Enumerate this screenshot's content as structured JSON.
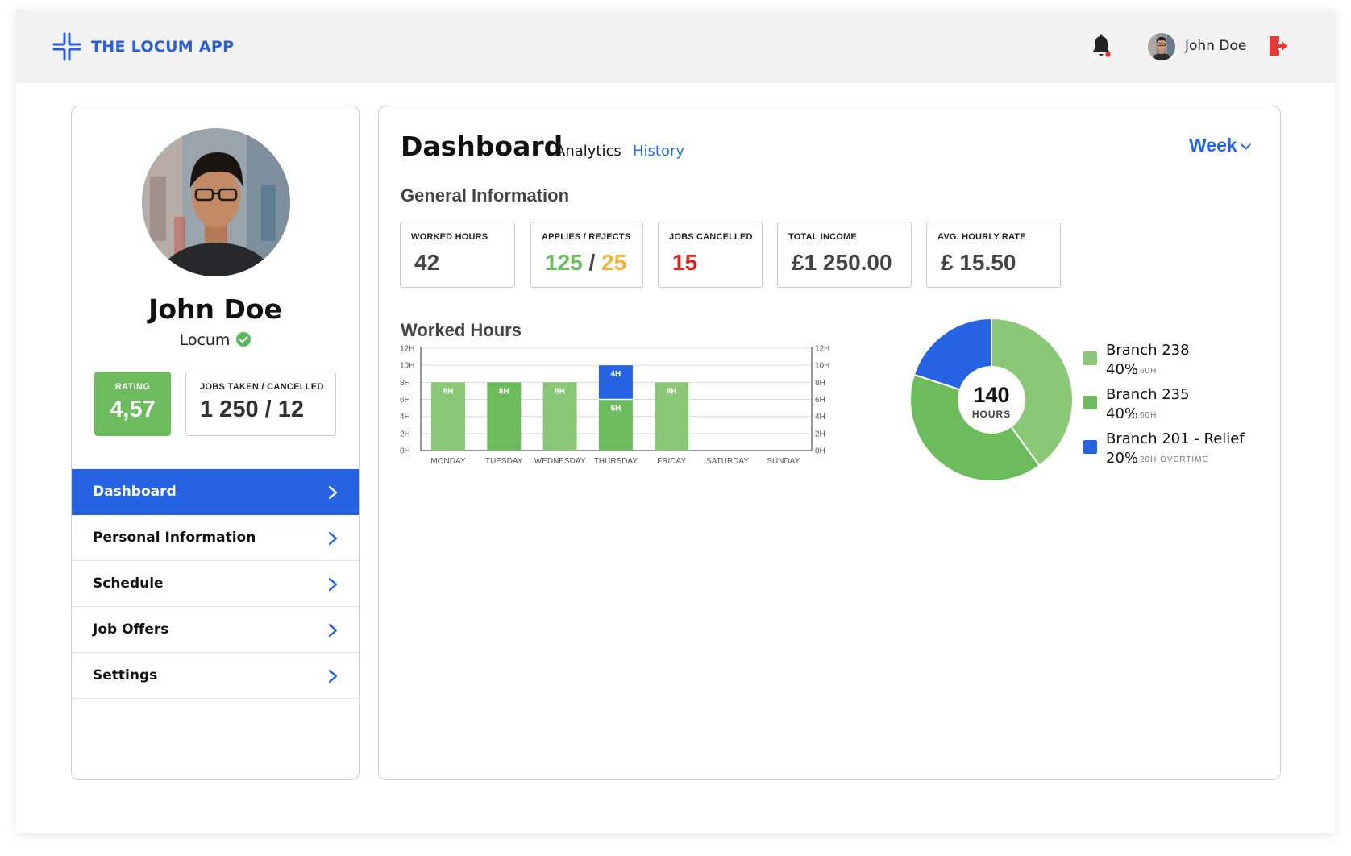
{
  "header": {
    "brand": "THE LOCUM APP",
    "user_name": "John Doe",
    "icons": [
      "logo-icon",
      "bell-icon",
      "avatar",
      "logout-icon"
    ],
    "notification_dot_color": "#e53935"
  },
  "profile": {
    "name": "John Doe",
    "role": "Locum",
    "rating_label": "RATING",
    "rating_value": "4,57",
    "jobs_label": "JOBS TAKEN / CANCELLED",
    "jobs_value": "1 250 / 12"
  },
  "nav": {
    "items": [
      {
        "label": "Dashboard",
        "active": true
      },
      {
        "label": "Personal Information",
        "active": false
      },
      {
        "label": "Schedule",
        "active": false
      },
      {
        "label": "Job Offers",
        "active": false
      },
      {
        "label": "Settings",
        "active": false
      }
    ]
  },
  "dashboard": {
    "title": "Dashboard",
    "tab_analytics": "Analytics",
    "tab_history": "History",
    "period": "Week",
    "general_title": "General Information",
    "worked_title": "Worked Hours",
    "cards": {
      "worked_hours": {
        "label": "WORKED HOURS",
        "value": "42"
      },
      "applies": {
        "label": "APPLIES / REJECTS",
        "applies": "125",
        "sep": " / ",
        "rejects": "25"
      },
      "jobs_cancelled": {
        "label": "JOBS CANCELLED",
        "value": "15"
      },
      "total_income": {
        "label": "TOTAL INCOME",
        "value": "£1 250.00"
      },
      "avg_rate": {
        "label": "AVG. HOURLY RATE",
        "value": "£ 15.50"
      }
    },
    "colors": {
      "green_light": "#8ac776",
      "green_mid": "#6cbc5e",
      "blue": "#2563e2",
      "applies_green": "#6cbc5e",
      "rejects_orange": "#f0b33b",
      "cancelled_red": "#d9251d"
    }
  },
  "chart_data": [
    {
      "type": "bar",
      "stacked": true,
      "categories": [
        "MONDAY",
        "TUESDAY",
        "WEDNESDAY",
        "THURSDAY",
        "FRIDAY",
        "SATURDAY",
        "SUNDAY"
      ],
      "series": [
        {
          "values": [
            8,
            8,
            8,
            6,
            8,
            0,
            0
          ],
          "colors": [
            "#8ac776",
            "#6cbc5e",
            "#8ac776",
            "#6cbc5e",
            "#8ac776",
            "#8ac776",
            "#8ac776"
          ]
        },
        {
          "values": [
            0,
            0,
            0,
            4,
            0,
            0,
            0
          ],
          "colors": [
            "#2563e2",
            "#2563e2",
            "#2563e2",
            "#2563e2",
            "#2563e2",
            "#2563e2",
            "#2563e2"
          ]
        }
      ],
      "data_labels": [
        [
          "8H",
          "8H",
          "8H",
          "6H",
          "8H",
          "",
          ""
        ],
        [
          "",
          "",
          "",
          "4H",
          "",
          "",
          ""
        ]
      ],
      "yticks": [
        "0H",
        "2H",
        "4H",
        "6H",
        "8H",
        "10H",
        "12H"
      ],
      "ylim": [
        0,
        12
      ],
      "grid": true,
      "dual_y_axis": true
    },
    {
      "type": "pie",
      "donut": true,
      "center_value": "140",
      "center_label": "HOURS",
      "slices": [
        {
          "name": "Branch 238",
          "value": 40,
          "percent": "40%",
          "detail": "60H",
          "color": "#8ac776"
        },
        {
          "name": "Branch 235",
          "value": 40,
          "percent": "40%",
          "detail": "60H",
          "color": "#6cbc5e"
        },
        {
          "name": "Branch 201 - Relief",
          "value": 20,
          "percent": "20%",
          "detail": "20H OVERTIME",
          "color": "#2563e2"
        }
      ],
      "legend": "right"
    }
  ]
}
